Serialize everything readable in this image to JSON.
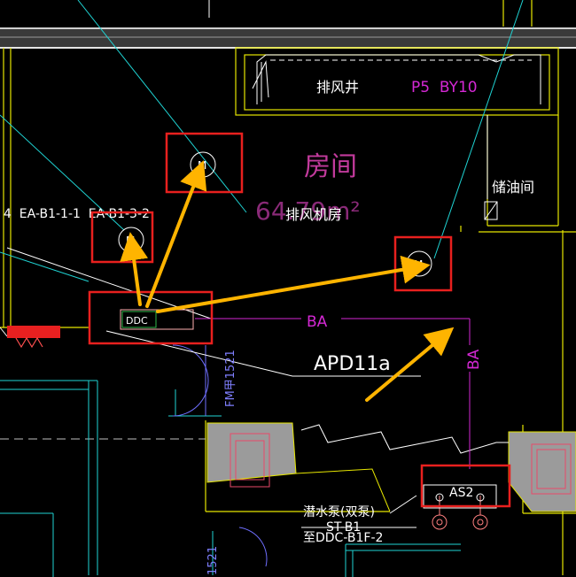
{
  "labels": {
    "exhaust_shaft": "排风井",
    "shaft_code": "P5  BY10",
    "room_title": "房间",
    "room_area": "64.79m²",
    "fan_room": "排风机房",
    "oil_storage": "储油间",
    "fan_tags": "4  EA-B1-1-1  EA-B1-3-2",
    "ddc": "DDC",
    "ba_horizontal": "BA",
    "ba_vertical": "BA",
    "apd": "APD11a",
    "fm_tag": "FM甲1521",
    "fm_tag_2": "1521",
    "as_tag": "AS2",
    "pump_label": "潜水泵(双泵)",
    "pump_code": "ST-B1",
    "to_ddc": "至DDC-B1F-2"
  },
  "devices": {
    "motor_symbol": "M"
  },
  "colors": {
    "highlight_box": "#e8201e",
    "arrow": "#ffb400",
    "wall": "#e6e600",
    "ba_line": "#d428d4",
    "room_text": "#c23a9c",
    "ddc_box": "#2fb84a",
    "cyan": "#1fd3d3",
    "white": "#ffffff"
  }
}
